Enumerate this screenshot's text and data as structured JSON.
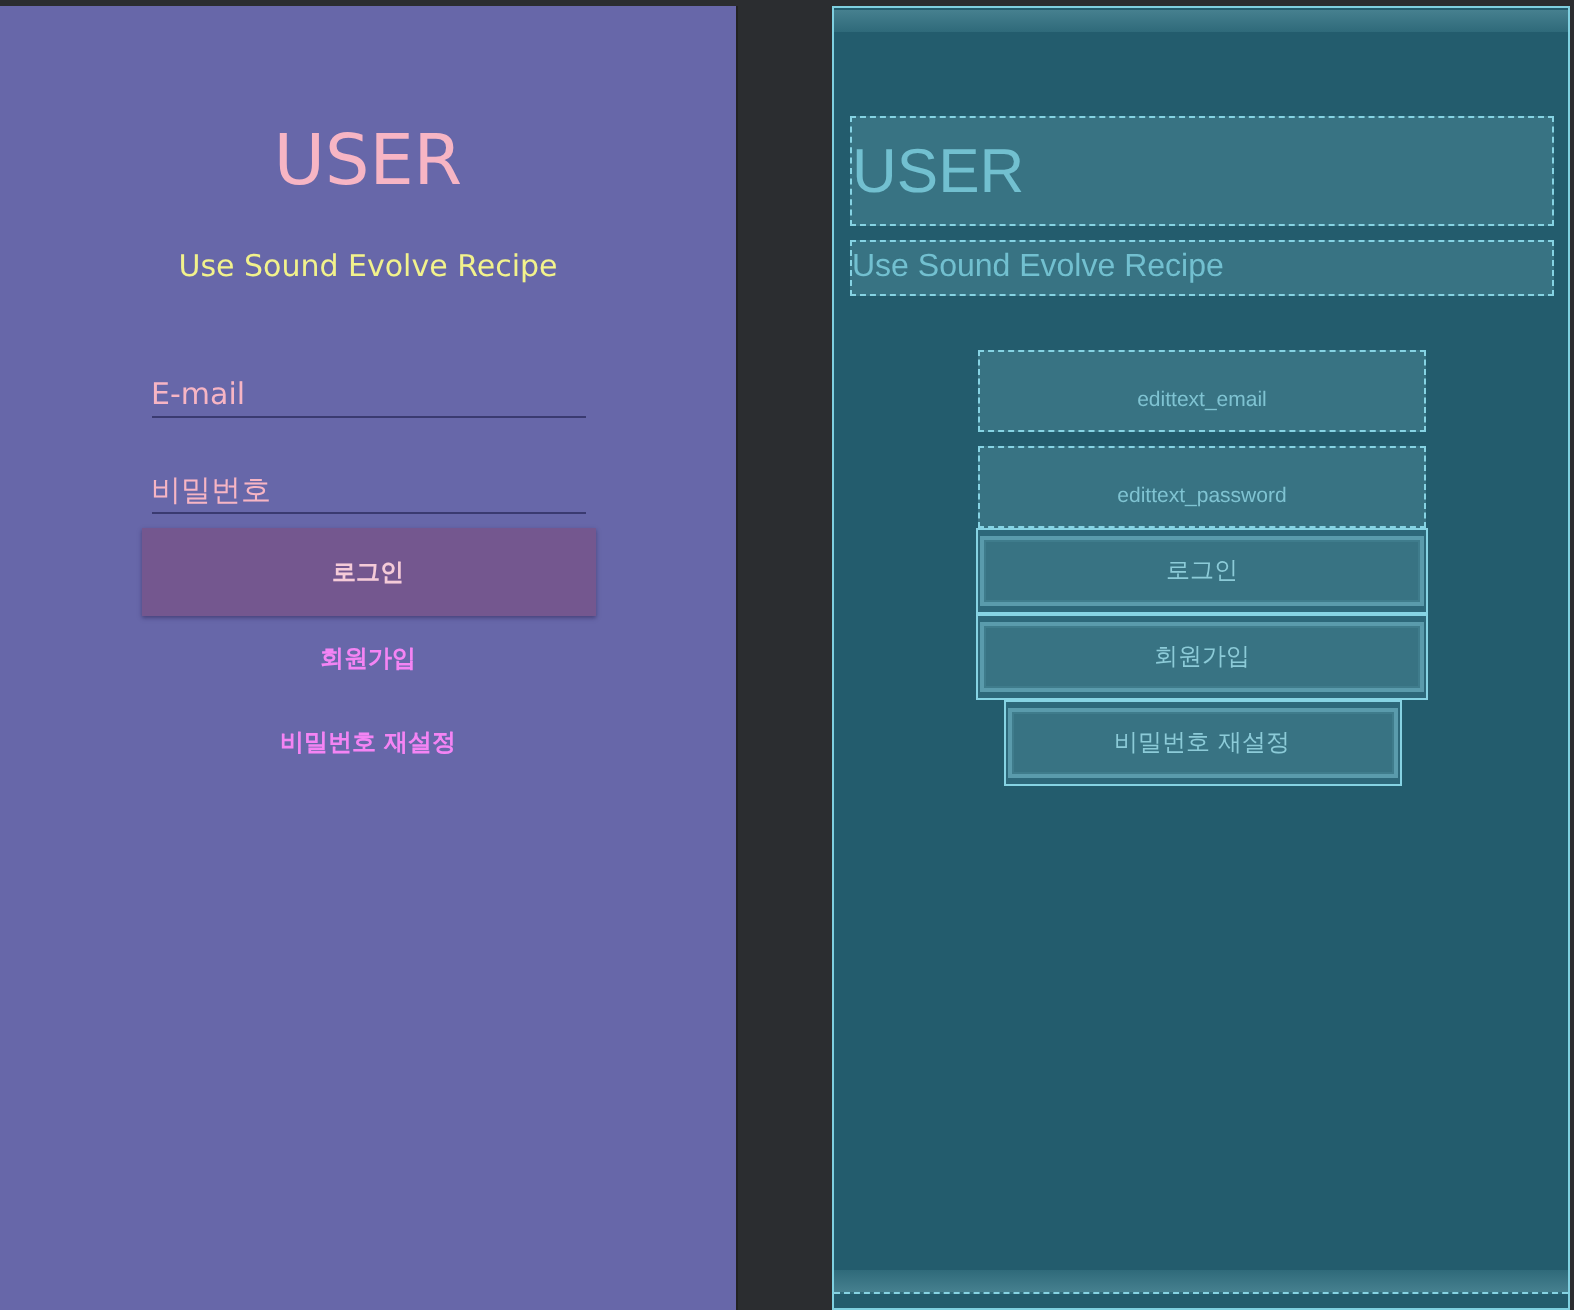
{
  "design_view": {
    "title": "USER",
    "subtitle": "Use Sound Evolve Recipe",
    "fields": [
      {
        "placeholder": "E-mail"
      },
      {
        "placeholder": "비밀번호"
      }
    ],
    "buttons": [
      {
        "label": "로그인",
        "kind": "filled"
      },
      {
        "label": "회원가입",
        "kind": "text"
      },
      {
        "label": "비밀번호 재설정",
        "kind": "text"
      }
    ]
  },
  "blueprint_view": {
    "title": "USER",
    "subtitle": "Use Sound Evolve Recipe",
    "fields": [
      {
        "label": "edittext_email"
      },
      {
        "label": "edittext_password"
      }
    ],
    "buttons": [
      {
        "label": "로그인",
        "kind": "wide"
      },
      {
        "label": "회원가입",
        "kind": "wide"
      },
      {
        "label": "비밀번호 재설정",
        "kind": "narrow"
      }
    ]
  }
}
